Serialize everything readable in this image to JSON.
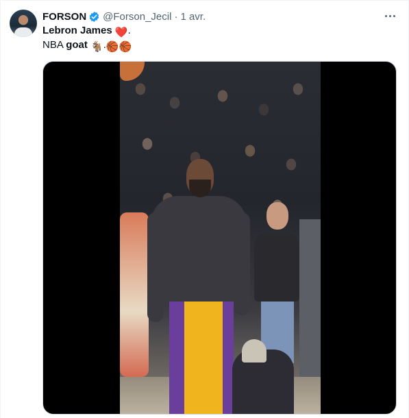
{
  "tweet": {
    "author": {
      "name": "FORSON",
      "handle": "@Forson_Jecil",
      "separator": "·",
      "date": "1 avr.",
      "verified": true,
      "verified_color": "#1d9bf0"
    },
    "text": {
      "line1_bold": "Lebron James",
      "line1_emoji": "❤️",
      "line1_suffix": ".",
      "line2_prefix": "NBA ",
      "line2_bold": "goat",
      "line2_emoji": "🐐",
      "line2_sep": ".",
      "line2_emoji2": "🏀🏀"
    },
    "media": {
      "type": "video"
    },
    "icons": {
      "more": "more-horizontal-icon",
      "verified": "verified-badge-icon"
    }
  }
}
